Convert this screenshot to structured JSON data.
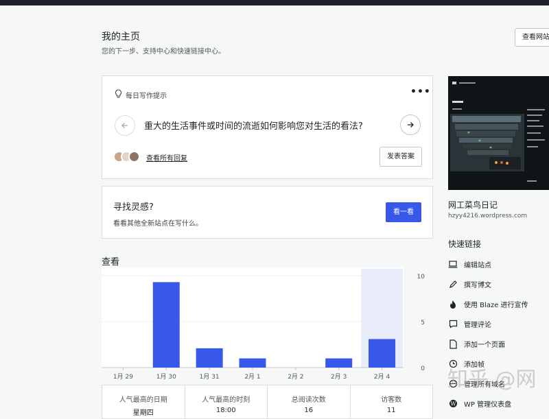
{
  "header": {
    "title": "我的主页",
    "subtitle": "您的下一步、支持中心和快速链接中心。",
    "view_site_label": "查看网站"
  },
  "prompt_card": {
    "label": "每日写作提示",
    "question": "重大的生活事件或时间的流逝如何影响您对生活的看法?",
    "view_replies": "查看所有回复",
    "post_answer": "发表答案"
  },
  "inspiration": {
    "title": "寻找灵感?",
    "subtitle": "看看其他全新站点在写什么。",
    "button": "看一看"
  },
  "stats": {
    "title": "查看",
    "table": [
      {
        "label": "人气最高的日期",
        "value": "星期四"
      },
      {
        "label": "人气最高的时刻",
        "value": "18:00"
      },
      {
        "label": "总阅读次数",
        "value": "16"
      },
      {
        "label": "访客数",
        "value": "11"
      }
    ]
  },
  "chart_data": {
    "type": "bar",
    "categories": [
      "1月 29",
      "1月 30",
      "1月 31",
      "2月 1",
      "2月 2",
      "2月 3",
      "2月 4"
    ],
    "values": [
      0,
      9.3,
      2.1,
      1.0,
      0,
      1.0,
      3.1
    ],
    "y_ticks": [
      "10",
      "5",
      "0"
    ],
    "ylim": [
      0,
      10
    ],
    "highlight_index": 6,
    "bar_color": "#3858e9",
    "highlight_color": "#e9edfb"
  },
  "site": {
    "name": "网工菜鸟日记",
    "url": "hzyy4216.wordpress.com"
  },
  "quick_links": {
    "title": "快速链接",
    "items": [
      {
        "label": "编辑站点",
        "icon": "laptop-icon"
      },
      {
        "label": "撰写博文",
        "icon": "pencil-icon"
      },
      {
        "label": "使用 Blaze 进行宣传",
        "icon": "flame-icon"
      },
      {
        "label": "管理评论",
        "icon": "comment-icon"
      },
      {
        "label": "添加一个页面",
        "icon": "page-icon"
      },
      {
        "label": "添加帧",
        "icon": "clock-icon"
      },
      {
        "label": "管理所有域名",
        "icon": "globe-icon"
      },
      {
        "label": "WP 管理仪表盘",
        "icon": "wordpress-icon"
      }
    ]
  },
  "watermark": "知乎 @网"
}
